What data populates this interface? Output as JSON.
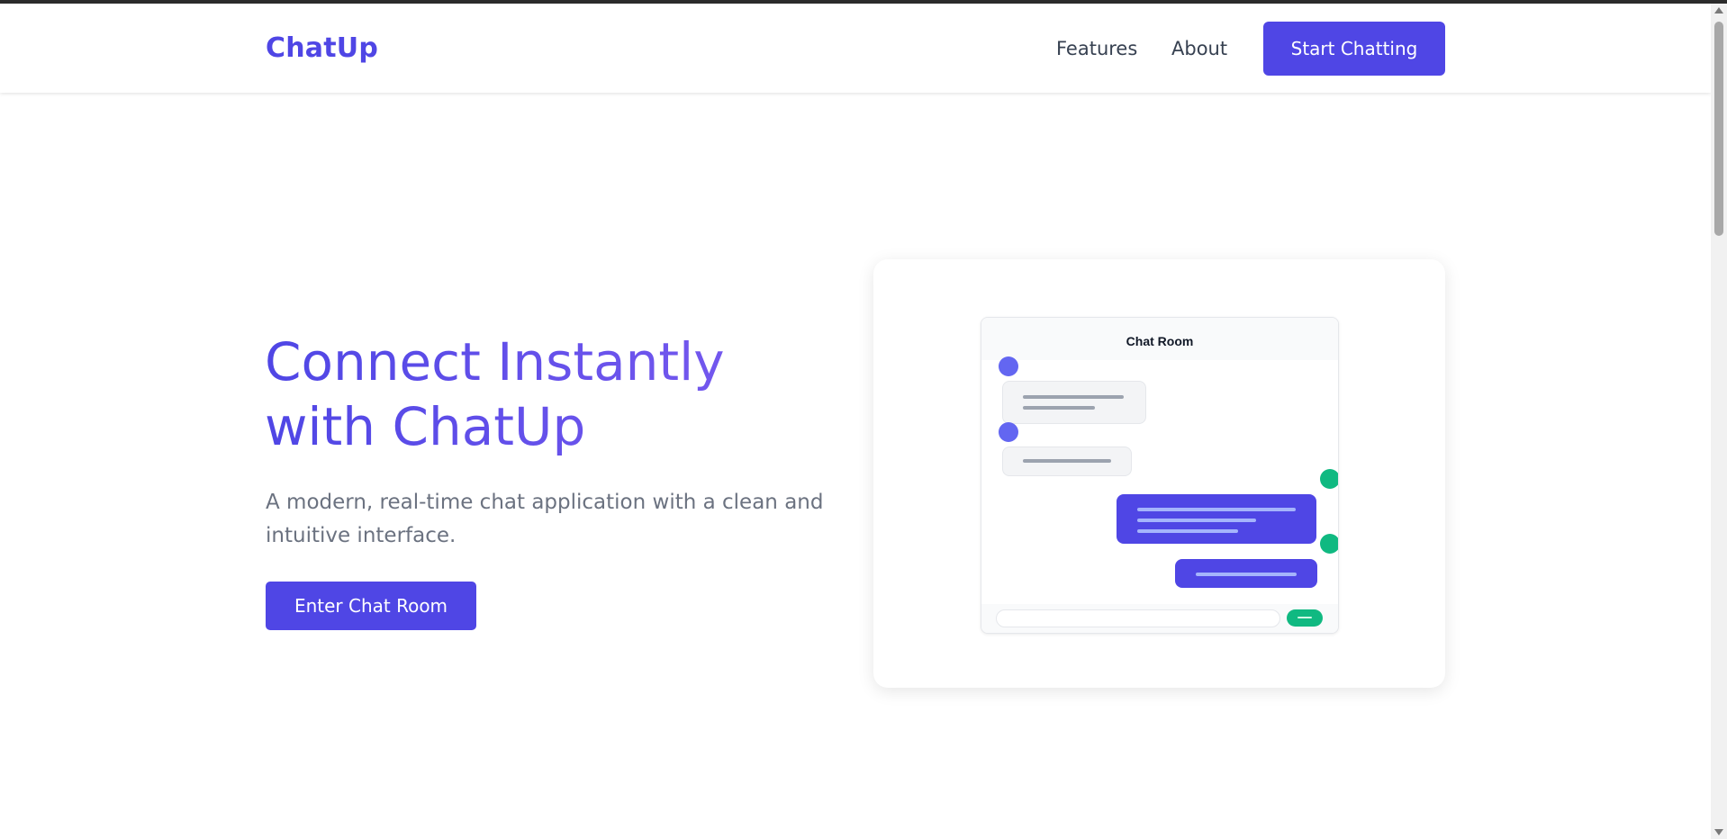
{
  "nav": {
    "brand": "ChatUp",
    "links": [
      {
        "label": "Features"
      },
      {
        "label": "About"
      }
    ],
    "cta_label": "Start Chatting"
  },
  "hero": {
    "title_line1": "Connect Instantly",
    "title_line2": "with ChatUp",
    "subtitle": "A modern, real-time chat application with a clean and intuitive interface.",
    "button_label": "Enter Chat Room"
  },
  "preview": {
    "window_title": "Chat Room",
    "incoming_color": "#6366f1",
    "outgoing_color": "#10b981"
  },
  "colors": {
    "brand": "#4f46e5",
    "accent_gradient_end": "#7c5cf0",
    "send_button": "#10b981",
    "body_text": "#6b7280"
  }
}
